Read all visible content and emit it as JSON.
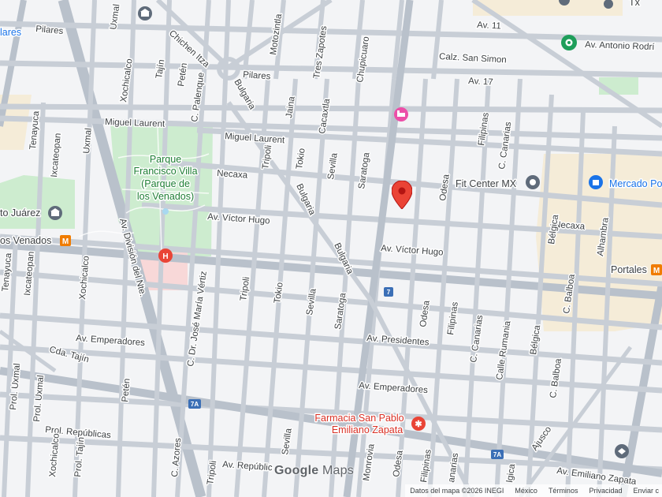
{
  "map": {
    "roads": {
      "pilares": "Pilares",
      "pilares_edge": "Pilares",
      "chichen_itza": "Chichen Itza",
      "motozintla": "Motozintla",
      "tres_zapotes": "Tres Zapotes",
      "chupicuaro": "Chupicuaro",
      "uxmal_top": "Uxmal",
      "xochicalco_top": "Xochicalco",
      "tajin": "Tajín",
      "peten_top": "Petén",
      "c_palenque": "C. Palenque",
      "bulgaria_top": "Bulgaria",
      "jaina": "Jaina",
      "cacaxtla": "Cacaxtla",
      "av_11": "Av. 11",
      "av_antonio": "Av. Antonio Rodrí",
      "calz_san_simon": "Calz. San Simon",
      "av_17": "Av. 17",
      "miguel_laurent_1": "Miguel Laurent",
      "miguel_laurent_2": "Miguel Laurent",
      "tenayuca": "Tenayuca",
      "ixcateopan_top": "Ixcateopan",
      "uxmal_mid": "Uxmal",
      "tripoli_top": "Tripoli",
      "tokio_top": "Tokio",
      "sevilla_top": "Sevilla",
      "saratoga_top": "Saratoga",
      "necaxa_1": "Necaxa",
      "necaxa_2": "Necaxa",
      "odesa_top": "Odesa",
      "filipinas_top": "Filipinas",
      "c_canarias_top": "C. Canarias",
      "bulgaria_mid": "Bulgaria",
      "bulgaria_low": "Bulgaria",
      "av_victor_hugo_1": "Av. Víctor Hugo",
      "av_victor_hugo_2": "Av. Víctor Hugo",
      "av_division": "Av. División del Nte.",
      "c_dr_jose": "C. Dr. José María Vértiz",
      "belgica_top": "Bélgica",
      "alhambra": "Alhambra",
      "c_balboa_top": "C. Balboa",
      "prol_uxmal_1": "Prol. Uxmal",
      "tenayuca_low": "Tenayuca",
      "ixcateopan_low": "Ixcateopan",
      "xochicalco_low": "Xochicalco",
      "tripoli_mid": "Tripoli",
      "tokio_mid": "Tokio",
      "sevilla_mid": "Sevilla",
      "saratoga_mid": "Saratoga",
      "odesa_mid": "Odesa",
      "filipinas_mid": "Filipinas",
      "c_canarias_mid": "C. Canarias",
      "calle_rumania": "Calle Rumania",
      "belgica_mid": "Bélgica",
      "c_balboa_mid": "C. Balboa",
      "av_emperadores_1": "Av. Emperadores",
      "av_presidentes": "Av. Presidentes",
      "cda_tajin": "Cda. Tajín",
      "av_emperadores_2": "Av. Emperadores",
      "prol_uxmal_2": "Prol. Uxmal",
      "peten_low": "Petén",
      "prol_republicas": "Prol. Repúblicas",
      "xochicalco_bottom": "Xochicalco",
      "prol_tajin": "Prol. Tajín",
      "c_azores": "C. Azores",
      "tripoli_low": "Tripoli",
      "sevilla_low": "Sevilla",
      "monrovia": "Monrovia",
      "odesa_low": "Odesa",
      "filipinas_low": "Filipinas",
      "canarias_low": "anarias",
      "belgica_low": "lgica",
      "ajusco": "Ajusco",
      "av_republicas": "Av. Repúblic",
      "av_emiliano": "Av. Emiliano Zapata"
    },
    "places": {
      "parque_line1": "Parque",
      "parque_line2": "Francisco Villa",
      "parque_line3": "(Parque de",
      "parque_line4": "los Venados)",
      "to_juarez": "to Juárez",
      "os_venados": "os Venados",
      "lares": "lares",
      "fit_center": "Fit Center MX",
      "mercado": "Mercado Po",
      "portales": "Portales",
      "farmacia_line1": "Farmacia San Pablo",
      "farmacia_line2": "Emiliano Zapata",
      "txt_top_right": "Tx"
    },
    "shields": {
      "a": "7",
      "b": "7A",
      "c": "7A",
      "hospital": "H"
    },
    "colors": {
      "road": "#c8ced6",
      "park": "#cdeccf",
      "commercial": "#f5ecd8",
      "marker": "#ea4335",
      "metro": "#f07c00"
    }
  },
  "branding": {
    "logo_google": "Google",
    "logo_maps": "Maps"
  },
  "footer": {
    "data": "Datos del mapa ©2026 INEGI",
    "country": "México",
    "terms": "Términos",
    "privacy": "Privacidad",
    "feedback": "Enviar c"
  }
}
